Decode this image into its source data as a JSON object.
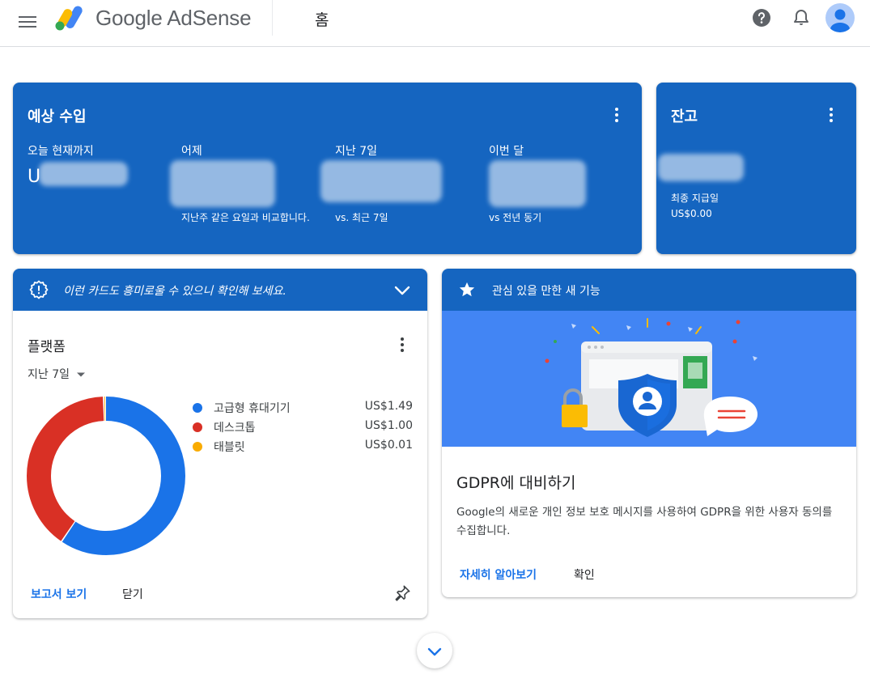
{
  "header": {
    "brand": "Google AdSense",
    "page_title": "홈"
  },
  "earnings": {
    "title": "예상 수입",
    "columns": [
      {
        "label": "오늘 현재까지",
        "note": ""
      },
      {
        "label": "어제",
        "note": "지난주 같은 요일과 비교합니다."
      },
      {
        "label": "지난 7일",
        "note": "vs. 최근 7일"
      },
      {
        "label": "이번 달",
        "note": "vs 전년 동기"
      }
    ],
    "today_partial": "U"
  },
  "balance": {
    "title": "잔고",
    "last_payment_label": "최종 지급일",
    "last_payment_value": "US$0.00"
  },
  "suggestion_banner": {
    "text": "이런 카드도 흥미로울 수 있으니 확인해 보세요."
  },
  "platform": {
    "title": "플랫폼",
    "range": "지난 7일",
    "actions": {
      "report": "보고서 보기",
      "close": "닫기"
    }
  },
  "chart_data": {
    "type": "pie",
    "categories": [
      "고급형 휴대기기",
      "데스크톱",
      "태블릿"
    ],
    "values": [
      1.49,
      1.0,
      0.01
    ],
    "value_labels": [
      "US$1.49",
      "US$1.00",
      "US$0.01"
    ],
    "colors": [
      "#1a73e8",
      "#d93025",
      "#f9ab00"
    ],
    "legend_placement": "right"
  },
  "feature": {
    "header": "관심 있을 만한 새 기능",
    "title": "GDPR에 대비하기",
    "body": "Google의 새로운 개인 정보 보호 메시지를 사용하여 GDPR을 위한 사용자 동의를 수집합니다.",
    "actions": {
      "learn_more": "자세히 알아보기",
      "confirm": "확인"
    }
  }
}
